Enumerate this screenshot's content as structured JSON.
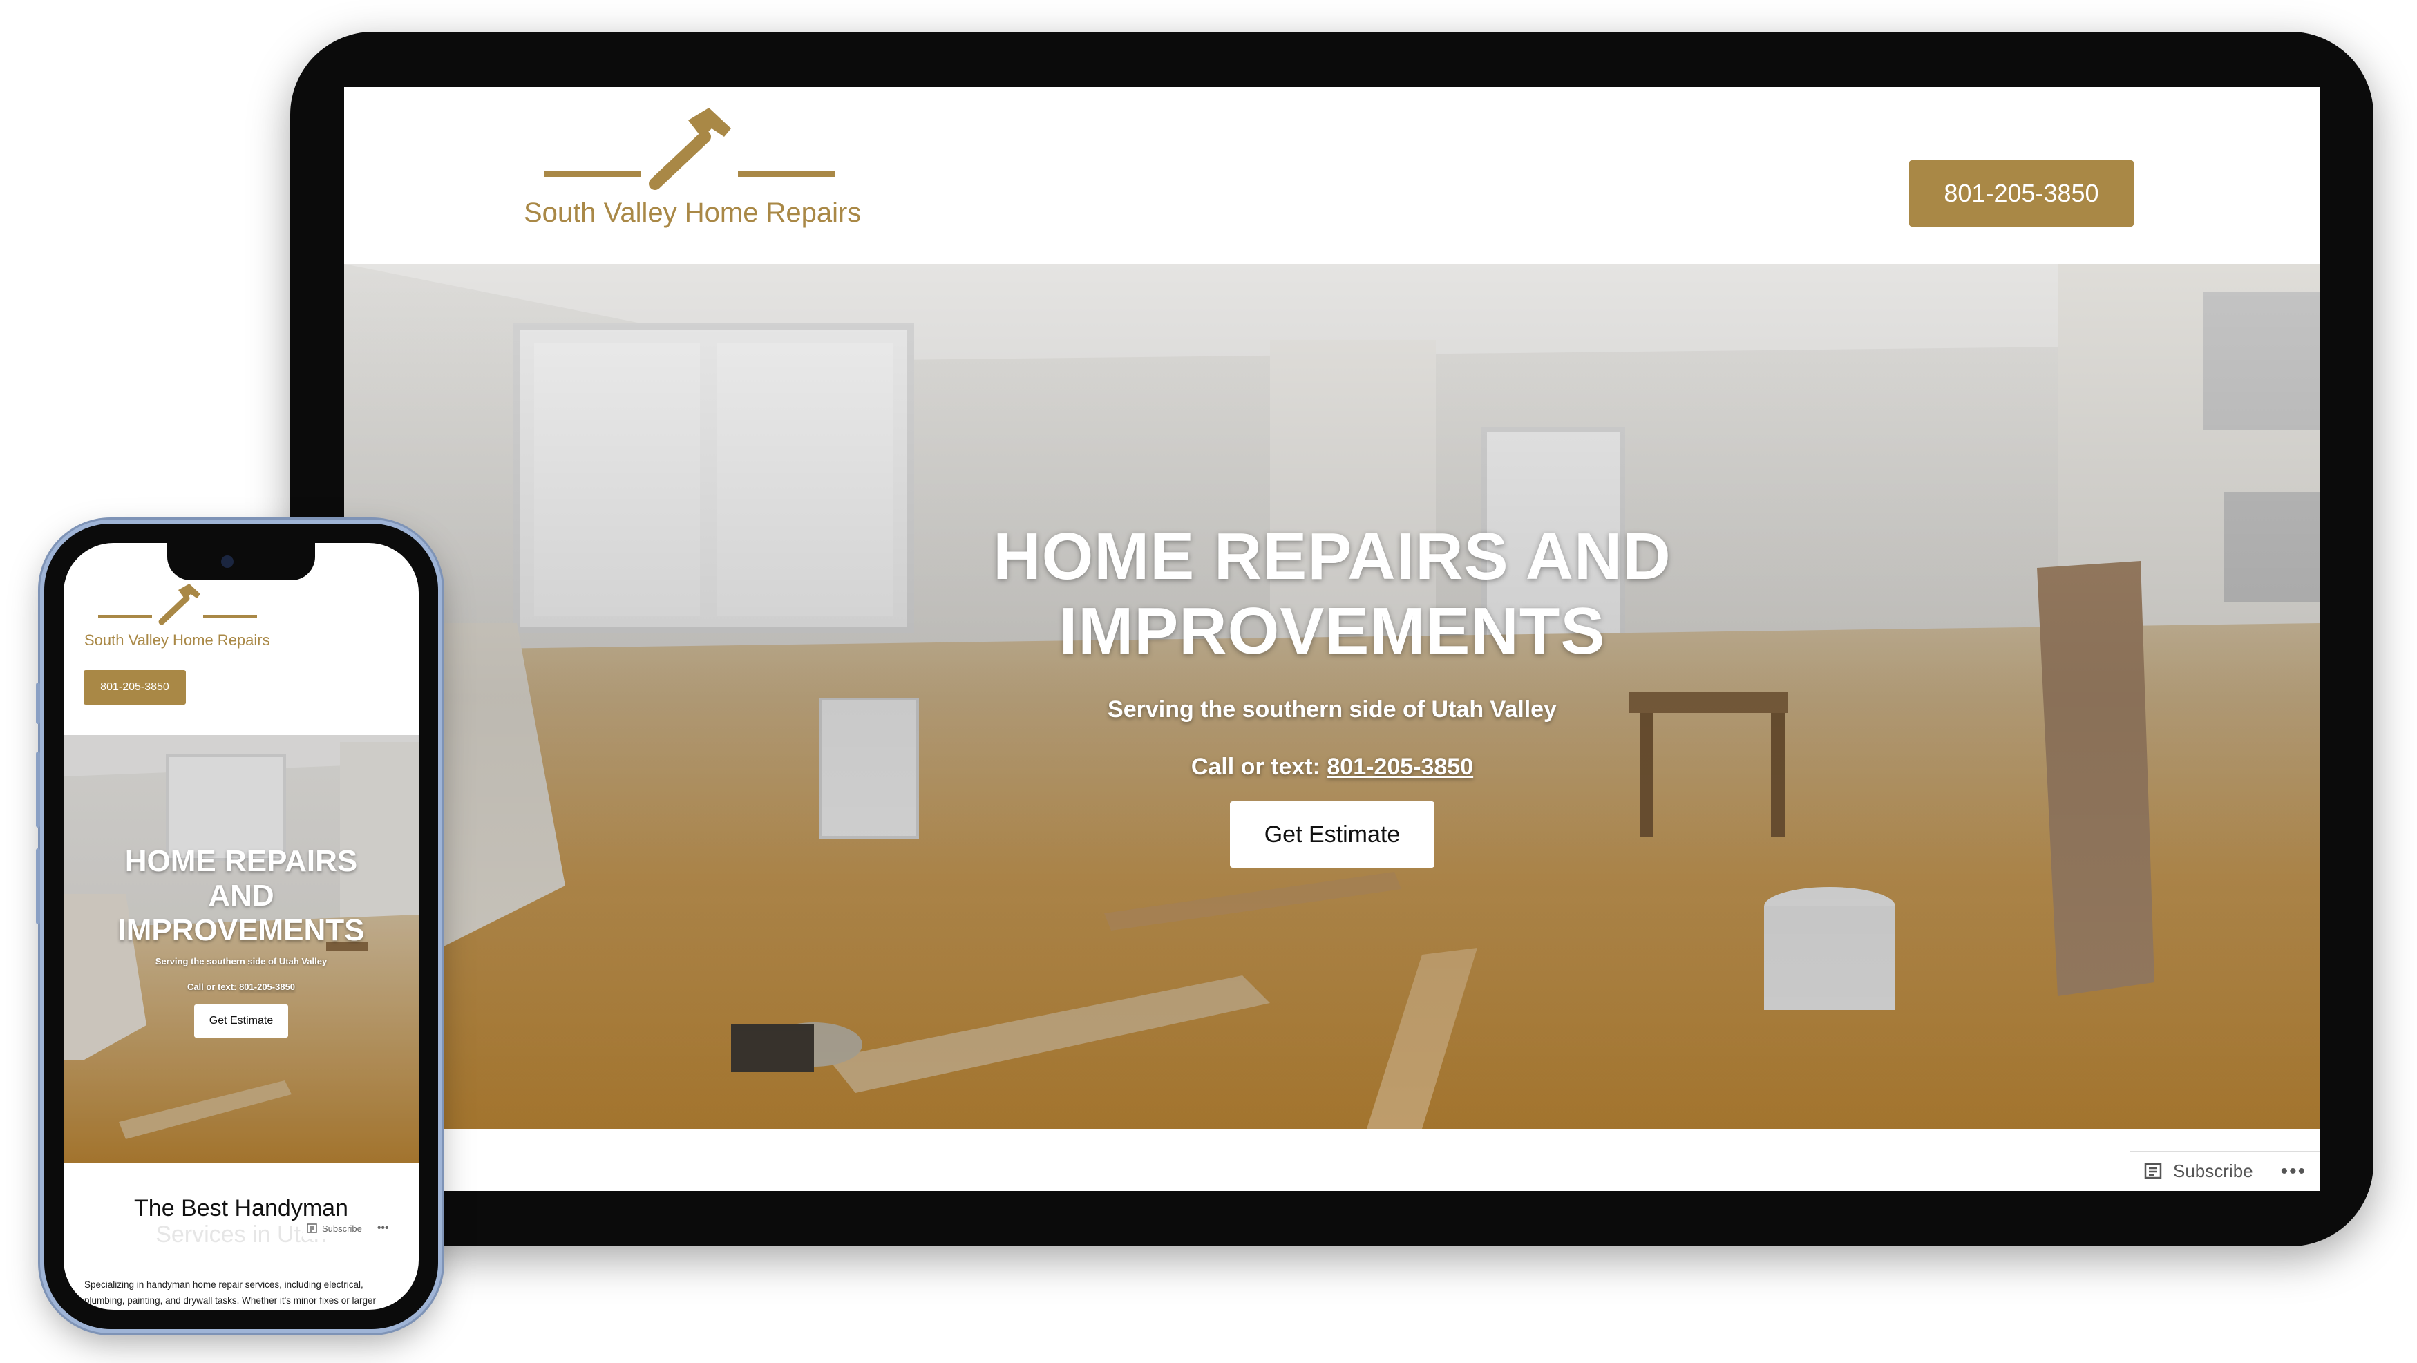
{
  "brand": {
    "name": "South Valley Home Repairs",
    "accent_color": "#a98846"
  },
  "tablet": {
    "header": {
      "phone_button": "801-205-3850"
    },
    "hero": {
      "heading": "HOME REPAIRS AND IMPROVEMENTS",
      "subheading": "Serving the southern side of Utah Valley",
      "call_label": "Call or text:",
      "call_number": "801-205-3850",
      "cta": "Get Estimate"
    },
    "subscribe_bar": {
      "subscribe_label": "Subscribe",
      "more_label": "•••"
    }
  },
  "phone": {
    "header": {
      "phone_button": "801-205-3850"
    },
    "hero": {
      "heading": "HOME REPAIRS AND IMPROVEMENTS",
      "subheading": "Serving the southern side of Utah Valley",
      "call_label": "Call or text:",
      "call_number": "801-205-3850",
      "cta": "Get Estimate"
    },
    "section": {
      "title": "The Best Handyman",
      "title_continued": "Services in Utah",
      "body": "Specializing in handyman home repair services, including electrical, plumbing, painting, and drywall tasks. Whether it's minor fixes or larger projects, the goal is to find reliable"
    },
    "subscribe_bar": {
      "subscribe_label": "Subscribe",
      "more_label": "•••"
    }
  }
}
